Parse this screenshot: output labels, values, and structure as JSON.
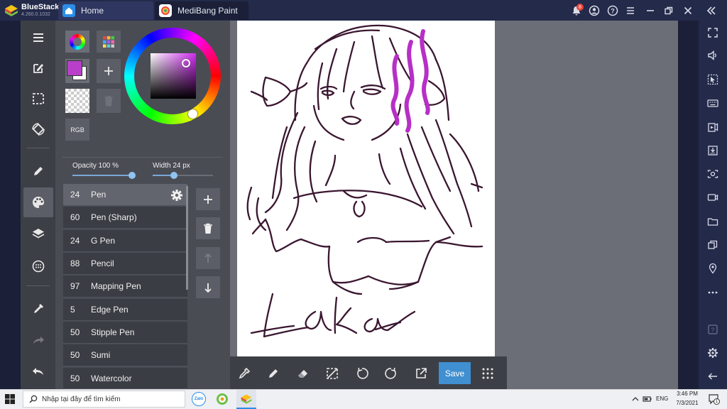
{
  "titlebar": {
    "brand": "BlueStacks",
    "version": "4.260.0.1032",
    "tabs": [
      {
        "label": "Home",
        "icon": "home-icon"
      },
      {
        "label": "MediBang Paint",
        "icon": "medibang-app-icon"
      }
    ],
    "notification_count": "8"
  },
  "colors": {
    "accent_purple": "#b72fc7",
    "primary_color": "#b83fc9",
    "save_blue": "#3f8fd1",
    "panel_bg": "#4a4c54",
    "stroke": "#3a1630"
  },
  "color_panel": {
    "rgb_label": "RGB"
  },
  "sliders": {
    "opacity_label": "Opacity 100 %",
    "opacity_value": 100,
    "width_label": "Width 24 px",
    "width_value": 24
  },
  "brushes": [
    {
      "width": "24",
      "name": "Pen"
    },
    {
      "width": "60",
      "name": "Pen (Sharp)"
    },
    {
      "width": "24",
      "name": "G Pen"
    },
    {
      "width": "88",
      "name": "Pencil"
    },
    {
      "width": "97",
      "name": "Mapping Pen"
    },
    {
      "width": "5",
      "name": "Edge Pen"
    },
    {
      "width": "50",
      "name": "Stipple Pen"
    },
    {
      "width": "50",
      "name": "Sumi"
    },
    {
      "width": "50",
      "name": "Watercolor"
    }
  ],
  "bottombar": {
    "save_label": "Save"
  },
  "taskbar": {
    "search_placeholder": "Nhập tại đây để tìm kiếm",
    "language": "ENG",
    "time": "3:46 PM",
    "date": "7/3/2021",
    "notification_count": "1"
  }
}
